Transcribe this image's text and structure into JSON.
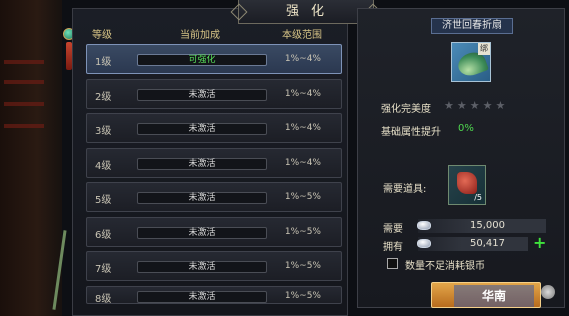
{
  "window": {
    "title": "强化"
  },
  "table": {
    "headers": {
      "level": "等级",
      "current_bonus": "当前加成",
      "range": "本级范围"
    },
    "rows": [
      {
        "level": "1级",
        "status": "可强化",
        "range": "1%~4%",
        "active": true
      },
      {
        "level": "2级",
        "status": "未激活",
        "range": "1%~4%",
        "active": false
      },
      {
        "level": "3级",
        "status": "未激活",
        "range": "1%~4%",
        "active": false
      },
      {
        "level": "4级",
        "status": "未激活",
        "range": "1%~4%",
        "active": false
      },
      {
        "level": "5级",
        "status": "未激活",
        "range": "1%~5%",
        "active": false
      },
      {
        "level": "6级",
        "status": "未激活",
        "range": "1%~5%",
        "active": false
      },
      {
        "level": "7级",
        "status": "未激活",
        "range": "1%~5%",
        "active": false
      },
      {
        "level": "8级",
        "status": "未激活",
        "range": "1%~5%",
        "active": false
      }
    ]
  },
  "item": {
    "name": "济世回春折扇",
    "icon": "folding-fan-icon",
    "badge": "绑",
    "perfection_label": "强化完美度",
    "perfection_stars": 0,
    "perfection_max_stars": 5,
    "attr_label": "基础属性提升",
    "attr_value": "0%"
  },
  "materials": {
    "label": "需要道具:",
    "icon": "red-gem-icon",
    "count": "/5"
  },
  "currency": {
    "required_label": "需要",
    "required_value": "15,000",
    "owned_label": "拥有",
    "owned_value": "50,417",
    "icon": "silver-ingot-icon",
    "plus_symbol": "+"
  },
  "option": {
    "checkbox_label": "数量不足消耗银币",
    "checked": false
  },
  "watermark": {
    "text": "华南"
  },
  "colors": {
    "accent_green": "#4fd84f",
    "active_row": "#3a4a63",
    "title_gold": "#d7c486"
  }
}
